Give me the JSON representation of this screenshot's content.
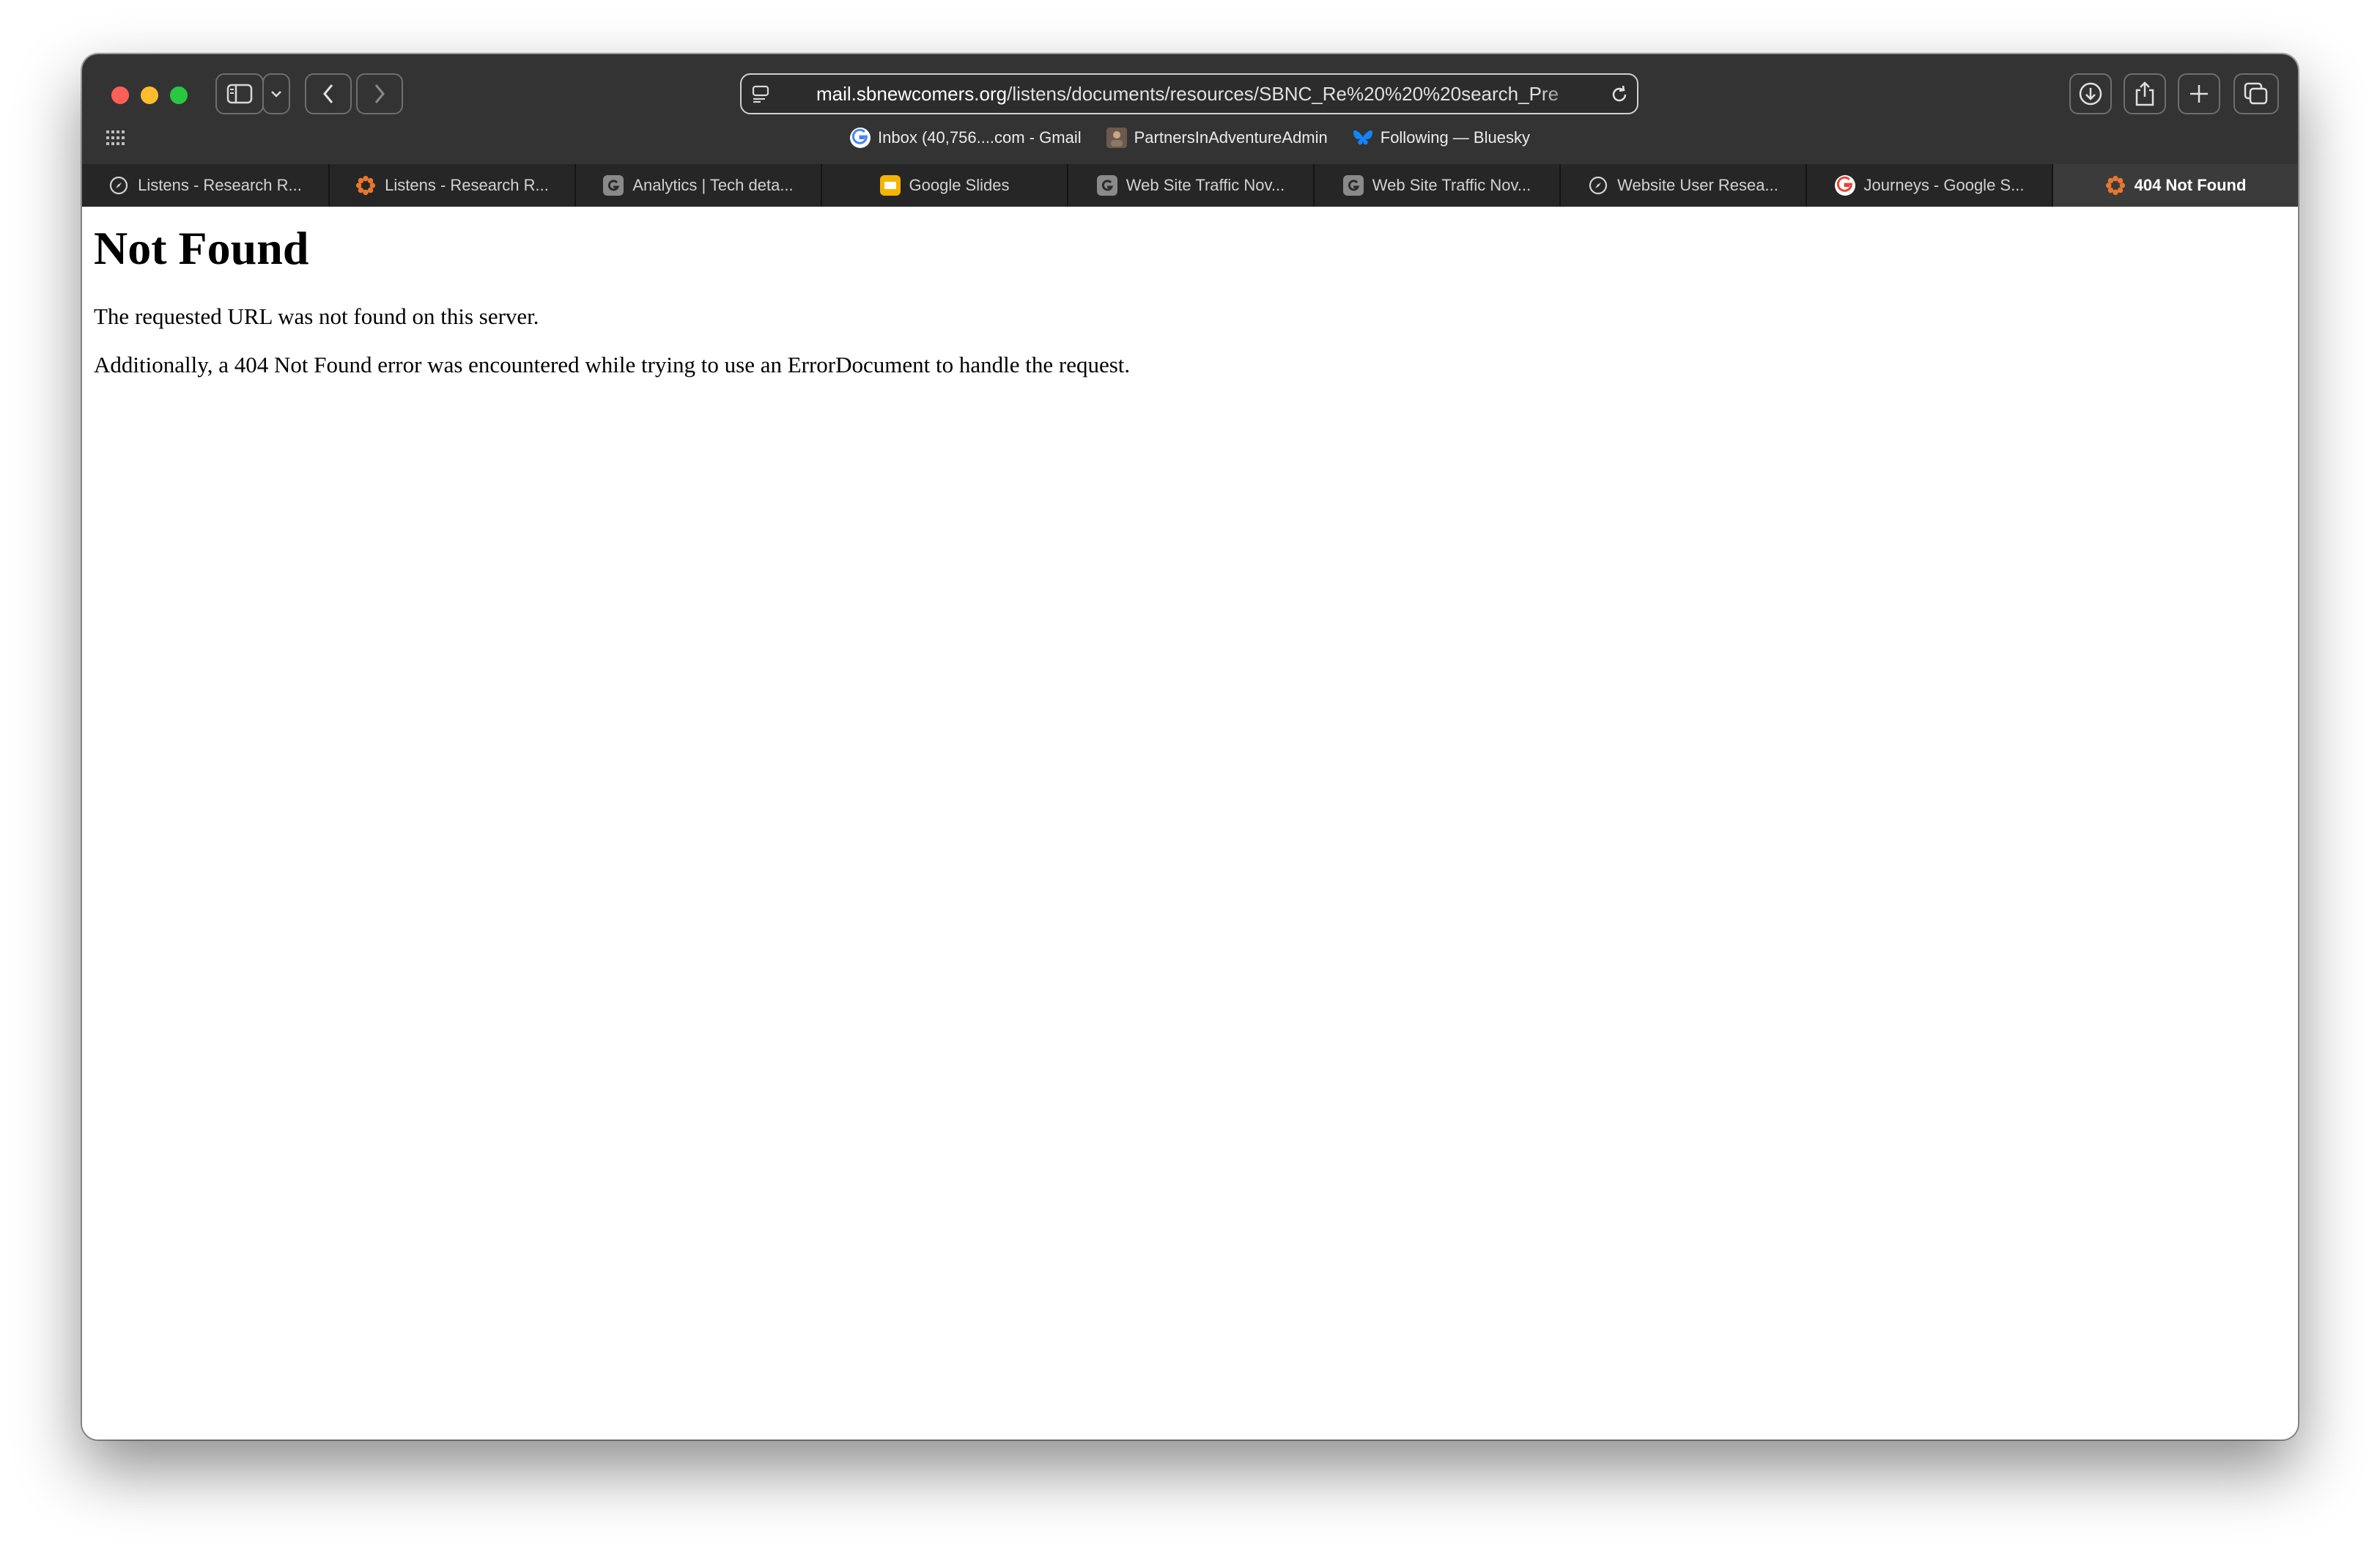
{
  "browser": {
    "url_host": "mail.sbnewcomers.org",
    "url_path": "/listens/documents/resources/SBNC_Re%20%20%20search_Pre"
  },
  "favorites": [
    {
      "label": "Inbox (40,756....com - Gmail",
      "icon": "google-icon"
    },
    {
      "label": "PartnersInAdventureAdmin",
      "icon": "avatar-icon"
    },
    {
      "label": "Following — Bluesky",
      "icon": "butterfly-icon"
    }
  ],
  "tabs": [
    {
      "label": "Listens - Research R...",
      "icon": "compass-icon",
      "active": false
    },
    {
      "label": "Listens - Research R...",
      "icon": "gear-flower-icon",
      "active": false
    },
    {
      "label": "Analytics | Tech deta...",
      "icon": "letter-g-icon",
      "active": false
    },
    {
      "label": "Google Slides",
      "icon": "slides-icon",
      "active": false
    },
    {
      "label": "Web Site Traffic Nov...",
      "icon": "letter-g-icon",
      "active": false
    },
    {
      "label": "Web Site Traffic Nov...",
      "icon": "letter-g-icon",
      "active": false
    },
    {
      "label": "Website User Resea...",
      "icon": "compass-icon",
      "active": false
    },
    {
      "label": "Journeys - Google S...",
      "icon": "google-icon",
      "active": false
    },
    {
      "label": "404 Not Found",
      "icon": "gear-flower-icon",
      "active": true
    }
  ],
  "page": {
    "heading": "Not Found",
    "message": "The requested URL was not found on this server.",
    "additional": "Additionally, a 404 Not Found error was encountered while trying to use an ErrorDocument to handle the request."
  },
  "colors": {
    "chrome": "#333334",
    "close": "#fe5f57",
    "minimize": "#febc2e",
    "zoom": "#28c840",
    "slides": "#f4b400",
    "orange": "#e8772e"
  }
}
